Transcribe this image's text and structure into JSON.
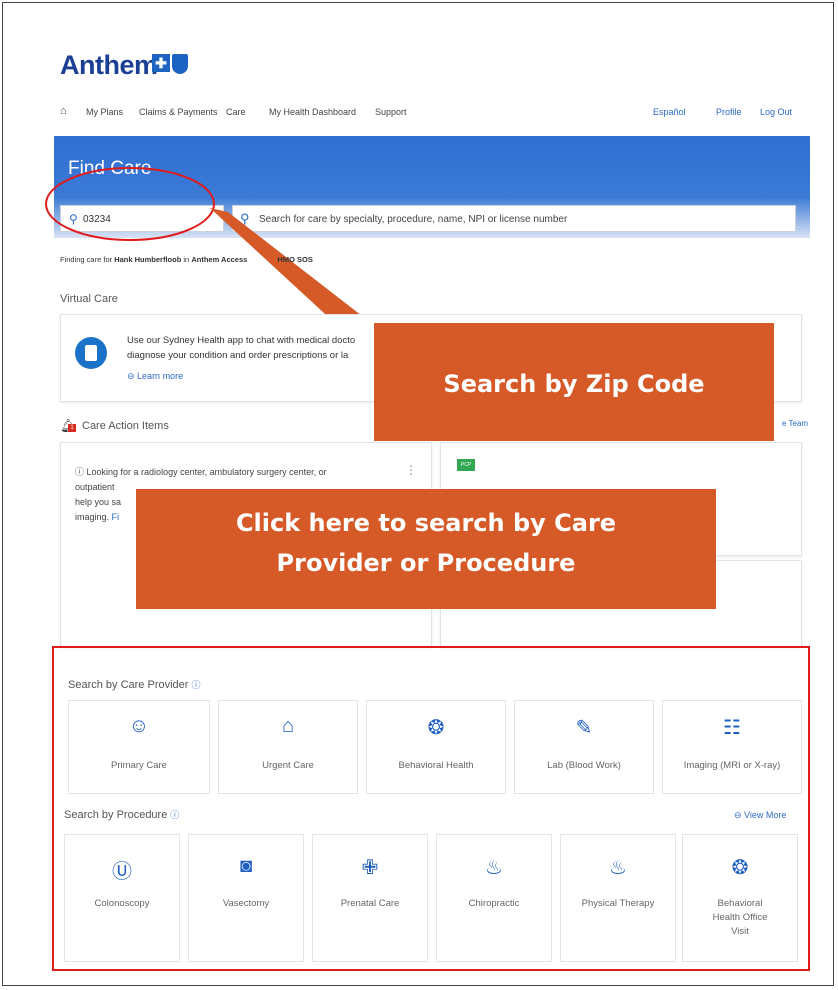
{
  "brand": {
    "name": "Anthem",
    "logo_mark": "bcbs-cross-shield"
  },
  "nav": {
    "home_icon": "house-icon",
    "items": [
      "My Plans",
      "Claims & Payments",
      "Care",
      "My Health Dashboard",
      "Support"
    ],
    "right": [
      "Español",
      "Profile",
      "Log Out"
    ]
  },
  "hero": {
    "title": "Find Care"
  },
  "search": {
    "zip": "03234",
    "placeholder": "Search for care by specialty, procedure, name, NPI or license number"
  },
  "finding": {
    "prefix": "Finding care for",
    "member": "Hank Humberfloob",
    "in": "in",
    "plan": "Anthem Access",
    "plan_suffix": "HMO SOS"
  },
  "virtual_care": {
    "label": "Virtual Care",
    "text": "Use our Sydney Health app to chat with medical docto",
    "text2": "diagnose your condition and order prescriptions or la",
    "learn_more": "Learn more"
  },
  "care_actions": {
    "label": "Care Action Items",
    "badge": "1",
    "team_link": "e Team",
    "radiology": "Looking for a radiology center, ambulatory surgery center, or",
    "radiology2": "outpatient",
    "radiology3": "help you sa",
    "radiology4": "imaging.",
    "radiology4_link": "Fi",
    "pcp_badge": "PCP"
  },
  "callouts": {
    "zip": "Search by Zip Code",
    "provider_line1": "Click here to search by Care",
    "provider_line2": "Provider or Procedure"
  },
  "provider_section": {
    "label": "Search by Care Provider",
    "tiles": [
      {
        "label": "Primary Care",
        "icon": "doctor-icon"
      },
      {
        "label": "Urgent Care",
        "icon": "urgent-care-icon"
      },
      {
        "label": "Behavioral Health",
        "icon": "brain-icon"
      },
      {
        "label": "Lab (Blood Work)",
        "icon": "syringe-icon"
      },
      {
        "label": "Imaging (MRI or X-ray)",
        "icon": "xray-icon"
      }
    ]
  },
  "procedure_section": {
    "label": "Search by Procedure",
    "view_more": "View More",
    "tiles": [
      {
        "label": "Colonoscopy",
        "icon": "colon-icon"
      },
      {
        "label": "Vasectomy",
        "icon": "vasectomy-icon"
      },
      {
        "label": "Prenatal Care",
        "icon": "medical-cross-icon"
      },
      {
        "label": "Chiropractic",
        "icon": "chiropractic-icon"
      },
      {
        "label": "Physical Therapy",
        "icon": "physical-therapy-icon"
      },
      {
        "label": "Behavioral Health Office Visit",
        "label_line1": "Behavioral",
        "label_line2": "Health Office",
        "label_line3": "Visit",
        "icon": "brain-icon"
      }
    ]
  },
  "colors": {
    "brand_blue": "#1a3f94",
    "hero_blue": "#2f6fd2",
    "callout_orange": "#d65a28",
    "highlight_red": "#e01b1b"
  }
}
